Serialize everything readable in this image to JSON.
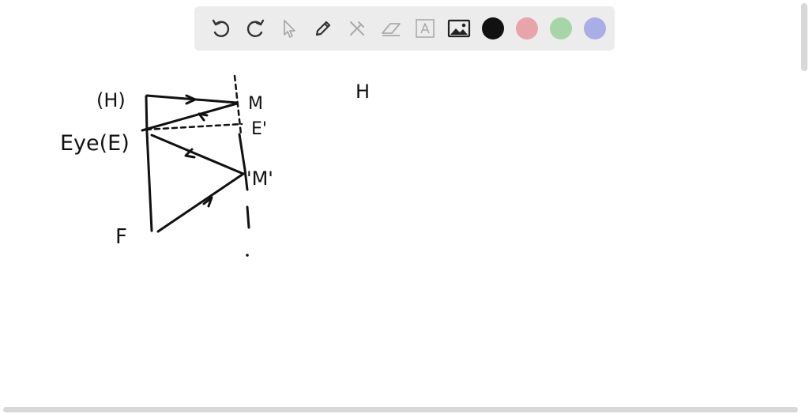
{
  "toolbar": {
    "tools": [
      {
        "name": "undo-icon"
      },
      {
        "name": "redo-icon"
      },
      {
        "name": "select-arrow-icon"
      },
      {
        "name": "pen-icon"
      },
      {
        "name": "tools-icon"
      },
      {
        "name": "eraser-icon"
      },
      {
        "name": "text-icon"
      },
      {
        "name": "image-icon"
      }
    ],
    "colors": [
      "#111111",
      "#e8a3ab",
      "#a8d5a8",
      "#a9aee6"
    ],
    "selected_color": "#111111"
  },
  "drawing": {
    "labels": {
      "h": "(H)",
      "eye": "Eye(E)",
      "f": "F",
      "m": "M",
      "e_prime": "E'",
      "m_prime": "'M'",
      "hi": "H"
    }
  }
}
